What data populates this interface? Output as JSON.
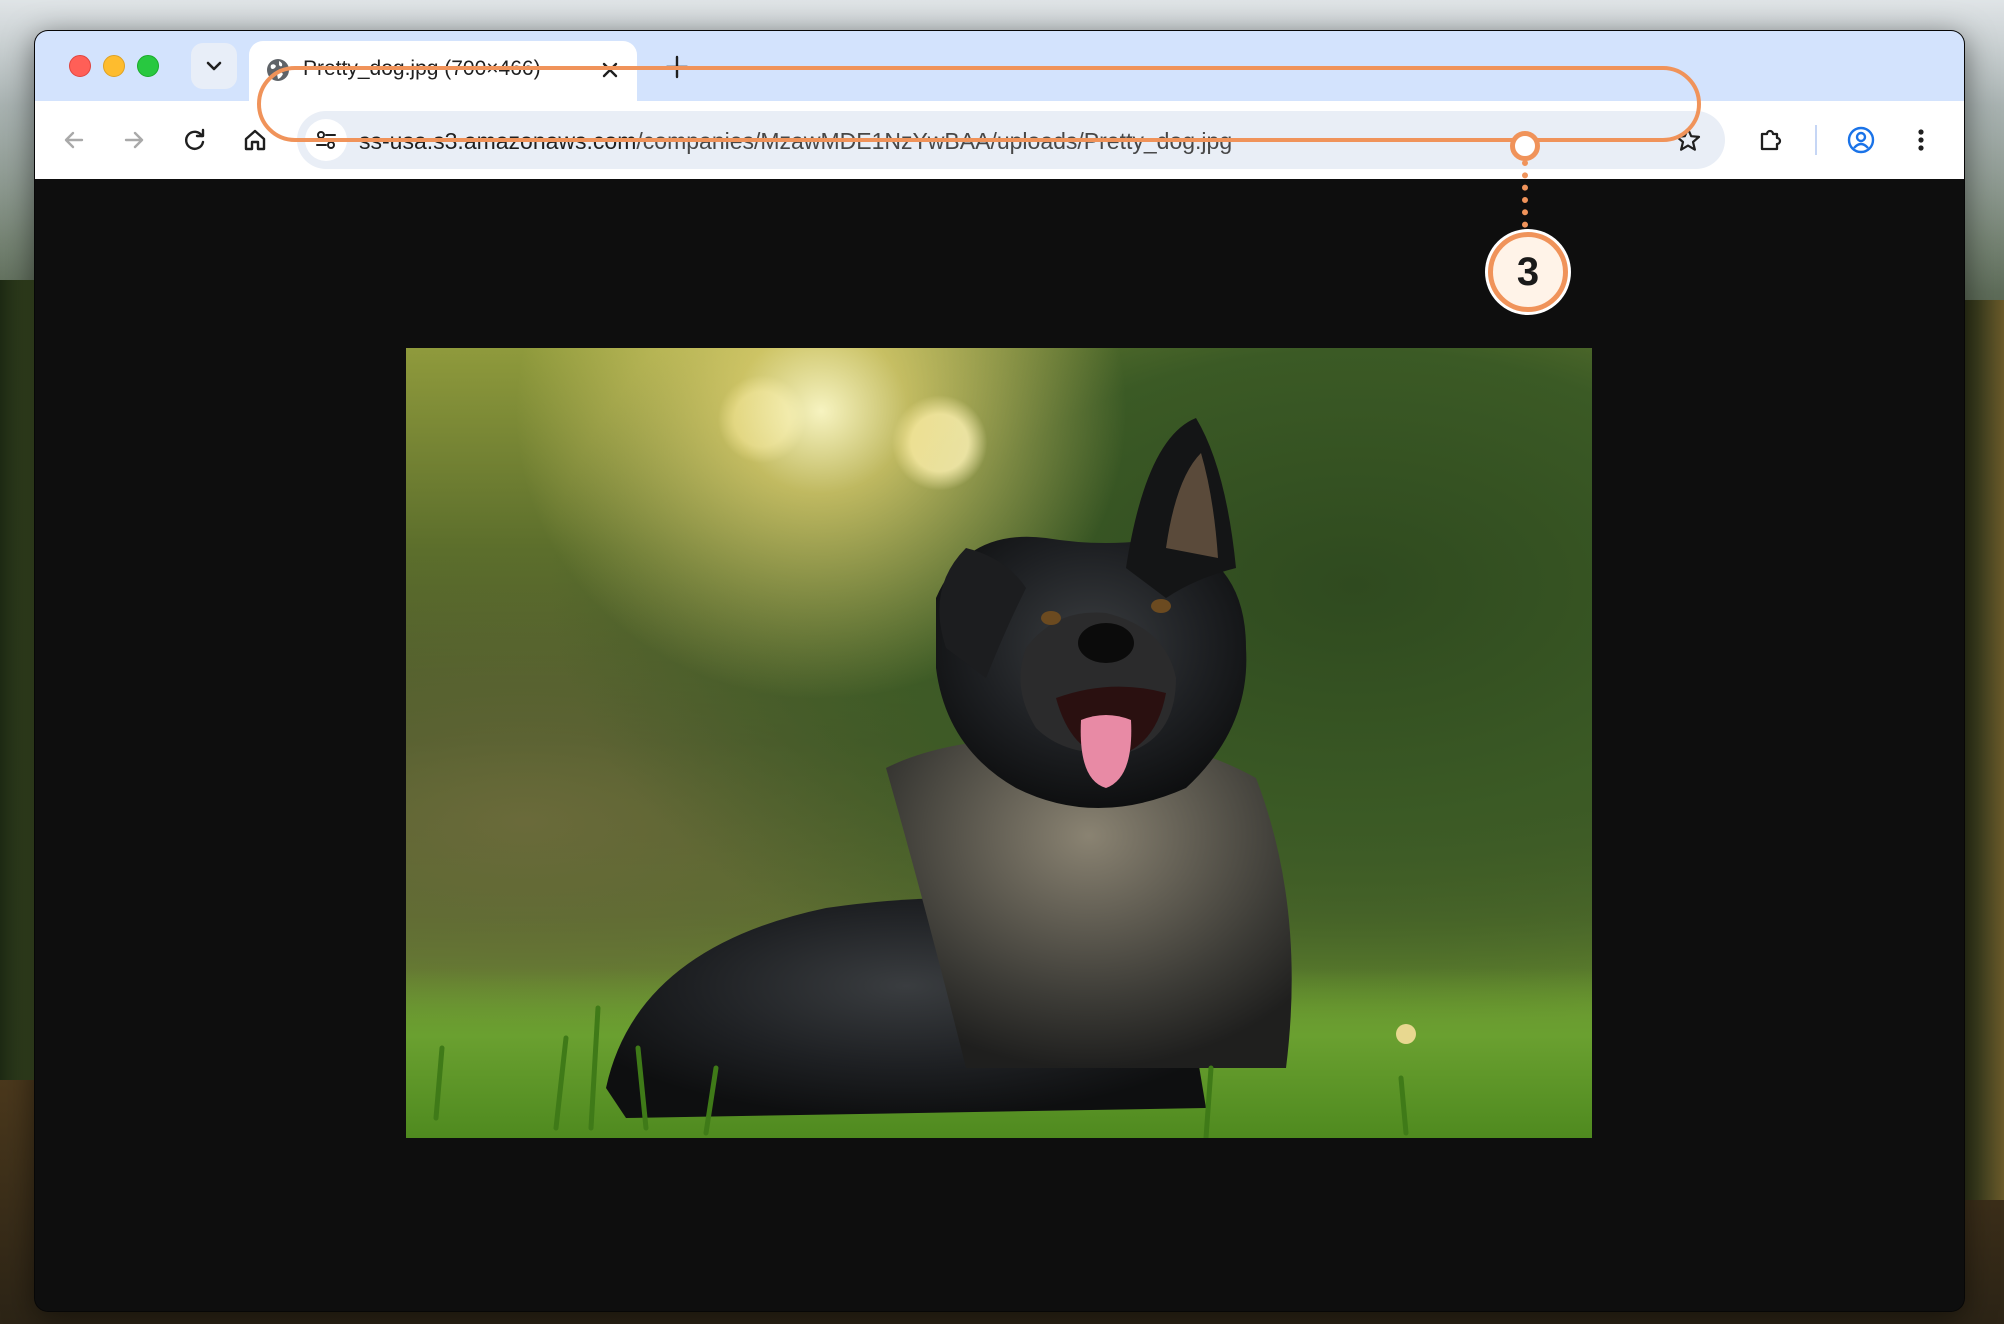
{
  "window": {
    "tab_title": "Pretty_dog.jpg (700×466)",
    "new_tab_icon": "plus-icon",
    "tab_icon": "globe-icon"
  },
  "toolbar": {
    "url_host": "ss-usa.s3.amazonaws.com",
    "url_path": "/companies/MzawMDE1NzYwBAA/uploads/Pretty_dog.jpg",
    "icons": [
      "back-arrow-icon",
      "forward-arrow-icon",
      "reload-icon",
      "home-icon",
      "tune-icon",
      "bookmark-star-icon",
      "extensions-puzzle-icon",
      "profile-icon",
      "kebab-menu-icon"
    ]
  },
  "annotation": {
    "step_number": "3",
    "color": "#f0935a"
  },
  "content": {
    "image_description_icon": "photo-dog",
    "viewer_background": "#0e0e0e"
  },
  "colors": {
    "tabstrip": "#d3e3fd",
    "omnibox": "#e9eef6",
    "accent_profile": "#1a73e8"
  }
}
